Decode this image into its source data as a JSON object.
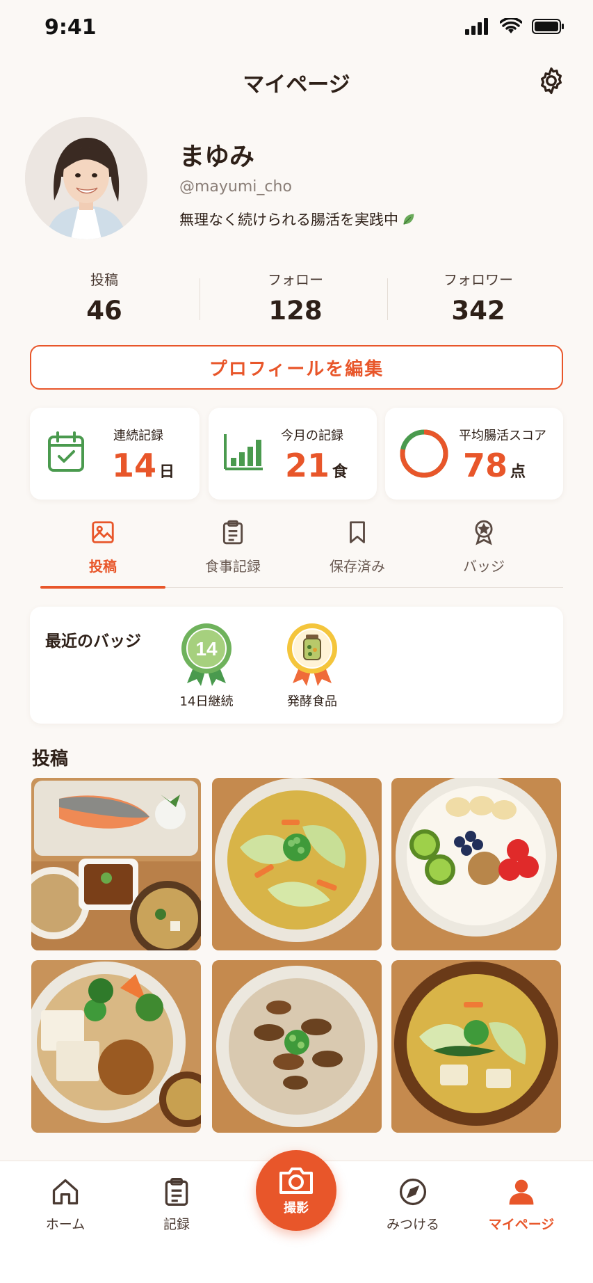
{
  "status_bar": {
    "time": "9:41"
  },
  "header": {
    "title": "マイページ"
  },
  "profile": {
    "name": "まゆみ",
    "handle": "@mayumi_cho",
    "bio": "無理なく続けられる腸活を実践中"
  },
  "stats": [
    {
      "label": "投稿",
      "value": "46"
    },
    {
      "label": "フォロー",
      "value": "128"
    },
    {
      "label": "フォロワー",
      "value": "342"
    }
  ],
  "edit_profile_label": "プロフィールを編集",
  "summary_cards": [
    {
      "label": "連続記録",
      "value": "14",
      "unit": "日"
    },
    {
      "label": "今月の記録",
      "value": "21",
      "unit": "食"
    },
    {
      "label": "平均腸活スコア",
      "value": "78",
      "unit": "点",
      "score_fraction": 0.78
    }
  ],
  "tabs": [
    {
      "label": "投稿",
      "icon": "image-icon",
      "active": true
    },
    {
      "label": "食事記録",
      "icon": "clipboard-icon",
      "active": false
    },
    {
      "label": "保存済み",
      "icon": "bookmark-icon",
      "active": false
    },
    {
      "label": "バッジ",
      "icon": "award-icon",
      "active": false
    }
  ],
  "badges": {
    "title": "最近のバッジ",
    "items": [
      {
        "label": "14日継続",
        "badge_text": "14",
        "icon": "ribbon-badge-icon"
      },
      {
        "label": "発酵食品",
        "icon": "jar-badge-icon"
      }
    ]
  },
  "posts": {
    "title": "投稿",
    "items": [
      "grilled-salmon-set-photo",
      "vegetable-soup-photo",
      "yogurt-fruit-bowl-photo",
      "tofu-natto-bowl-photo",
      "mushroom-porridge-photo",
      "miso-soup-photo"
    ]
  },
  "bottom_nav": [
    {
      "label": "ホーム",
      "icon": "home-icon",
      "active": false
    },
    {
      "label": "記録",
      "icon": "clipboard-icon",
      "active": false
    },
    {
      "label": "撮影",
      "icon": "camera-icon",
      "active": false
    },
    {
      "label": "みつける",
      "icon": "compass-icon",
      "active": false
    },
    {
      "label": "マイページ",
      "icon": "person-icon",
      "active": true
    }
  ],
  "colors": {
    "accent": "#e8562a",
    "green": "#4a9a4e",
    "background": "#fbf8f5"
  }
}
